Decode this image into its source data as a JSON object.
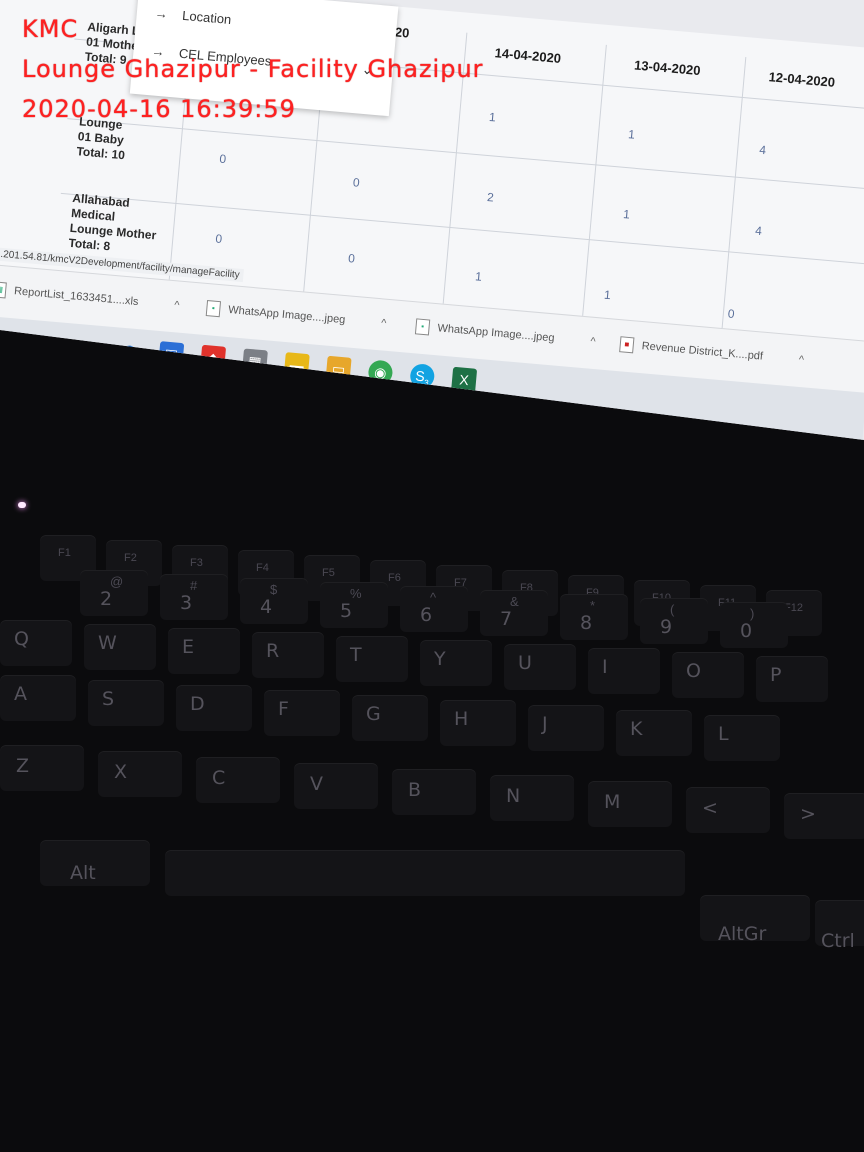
{
  "stamp": {
    "line1": "KMC",
    "line2": "Lounge Ghazipur - Facility Ghazipur",
    "line3": "2020-04-16 16:39:59"
  },
  "dropdown": {
    "items": [
      "Location",
      "CEL Employees"
    ]
  },
  "table": {
    "date_headers": [
      "-2020",
      "14-04-2020",
      "13-04-2020",
      "12-04-2020"
    ],
    "rows": [
      {
        "label": "Aligarh L\n01 Mothe\nTotal: 9",
        "values": [
          "1",
          "1",
          "4"
        ]
      },
      {
        "label": "Lounge\n01 Baby\nTotal: 10",
        "values": [
          "0",
          "0",
          "2",
          "1",
          "4"
        ]
      },
      {
        "label": "Allahabad\nMedical\nLounge Mother\nTotal: 8",
        "values": [
          "0",
          "0",
          "1",
          "1",
          "0"
        ]
      }
    ]
  },
  "status_url": "52.201.54.81/kmcV2Development/facility/manageFacility",
  "downloads": [
    {
      "name": "ReportList_1633451....xls",
      "icon": "excel-file-icon"
    },
    {
      "name": "WhatsApp Image....jpeg",
      "icon": "image-file-icon"
    },
    {
      "name": "WhatsApp Image....jpeg",
      "icon": "image-file-icon"
    },
    {
      "name": "Revenue District_K....pdf",
      "icon": "pdf-file-icon"
    }
  ],
  "taskbar": {
    "icons": [
      "windows-start-icon",
      "search-circle-icon",
      "task-view-icon",
      "edge-icon",
      "store-icon",
      "anydesk-icon",
      "calculator-icon",
      "sticky-notes-icon",
      "file-explorer-icon",
      "chrome-icon",
      "skype-icon",
      "excel-icon"
    ],
    "skype_badge": "3"
  },
  "keyboard": {
    "row_num": [
      "2",
      "3",
      "4",
      "5",
      "6",
      "7",
      "8",
      "9",
      "0"
    ],
    "row_num_top": [
      "@",
      "#",
      "$",
      "%",
      "^",
      "&",
      "*",
      "(",
      ")"
    ],
    "row_q": [
      "Q",
      "W",
      "E",
      "R",
      "T",
      "Y",
      "U",
      "I",
      "O",
      "P"
    ],
    "row_a": [
      "A",
      "S",
      "D",
      "F",
      "G",
      "H",
      "J",
      "K",
      "L"
    ],
    "row_z": [
      "Z",
      "X",
      "C",
      "V",
      "B",
      "N",
      "M",
      "<",
      ">"
    ],
    "alt_left": "Alt",
    "alt_right": "AltGr",
    "ctrl_right": "Ctrl",
    "fkey_labels": [
      "F1",
      "F2",
      "F3",
      "F4",
      "F5",
      "F6",
      "F7",
      "F8",
      "F9",
      "F10",
      "F11",
      "F12"
    ]
  }
}
